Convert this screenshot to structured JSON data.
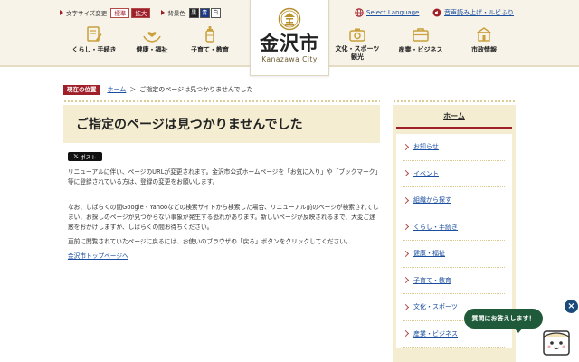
{
  "header": {
    "font_size_label": "文字サイズ変更",
    "font_size_normal": "標準",
    "font_size_large": "拡大",
    "bg_color_label": "背景色",
    "bg_black": "黒",
    "bg_blue": "青",
    "bg_white": "白",
    "select_language": "Select Language",
    "read_aloud": "音声読み上げ・ルビふり",
    "logo_kanji": "金沢市",
    "logo_en": "Kanazawa City",
    "nav_left": [
      {
        "label": "くらし・手続き",
        "icon": "form-icon"
      },
      {
        "label": "健康・福祉",
        "icon": "hands-heart-icon"
      },
      {
        "label": "子育て・教育",
        "icon": "baby-bottle-icon"
      }
    ],
    "nav_right": [
      {
        "label": "文化・スポーツ 観光",
        "icon": "camera-icon"
      },
      {
        "label": "産業・ビジネス",
        "icon": "briefcase-icon"
      },
      {
        "label": "市政情報",
        "icon": "city-hall-icon"
      }
    ]
  },
  "breadcrumb": {
    "here_label": "現在の位置",
    "home": "ホーム",
    "separator": "＞",
    "current": "ご指定のページは見つかりませんでした"
  },
  "main": {
    "title": "ご指定のページは見つかりませんでした",
    "post_label": "ポスト",
    "paragraph1": "リニューアルに伴い、ページのURLが変更されます。金沢市公式ホームページを「お気に入り」や「ブックマーク」等に登録されている方は、登録の変更をお願いします。",
    "paragraph2": "なお、しばらくの間Google・Yahooなどの検索サイトから検索した場合、リニューアル前のページが検索されてしまい、お探しのページが見つからない事象が発生する恐れがあります。新しいページが反映されるまで、大変ご迷惑をおかけしますが、しばらくの間お待ちください。",
    "paragraph3": "直前に閲覧されていたページに戻るには、お使いのブラウザの「戻る」ボタンをクリックしてください。",
    "top_link": "金沢市トップページへ"
  },
  "sidebar": {
    "heading": "ホーム",
    "items": [
      {
        "label": "お知らせ"
      },
      {
        "label": "イベント"
      },
      {
        "label": "組織から探す"
      },
      {
        "label": "くらし・手続き"
      },
      {
        "label": "健康・福祉"
      },
      {
        "label": "子育て・教育"
      },
      {
        "label": "文化・スポーツ"
      },
      {
        "label": "産業・ビジネス"
      }
    ]
  },
  "chat": {
    "bubble": "質問にお答えします！",
    "close": "×"
  },
  "colors": {
    "accent_red": "#a0202a",
    "link_blue": "#1a4ea0",
    "beige": "#f4edd2",
    "chat_green": "#1f5a3a"
  }
}
